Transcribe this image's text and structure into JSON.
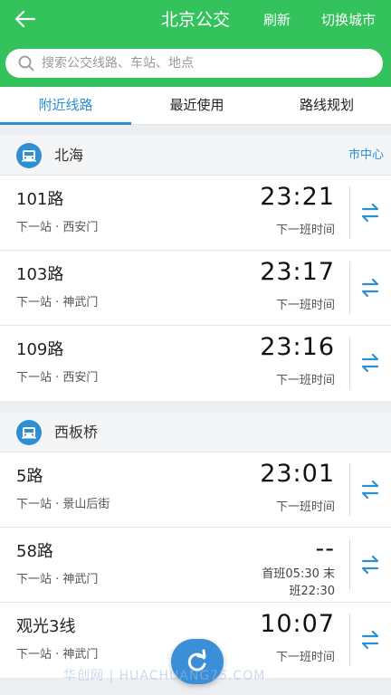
{
  "header": {
    "title": "北京公交",
    "refresh_label": "刷新",
    "switch_city_label": "切换城市"
  },
  "search": {
    "placeholder": "搜索公交线路、车站、地点"
  },
  "tabs": [
    {
      "label": "附近线路",
      "active": true
    },
    {
      "label": "最近使用",
      "active": false
    },
    {
      "label": "路线规划",
      "active": false
    }
  ],
  "groups": [
    {
      "stop_name": "北海",
      "area": "市中心",
      "routes": [
        {
          "name": "101路",
          "next_stop": "下一站 · 西安门",
          "time": "23:21",
          "time_label": "下一班时间"
        },
        {
          "name": "103路",
          "next_stop": "下一站 · 神武门",
          "time": "23:17",
          "time_label": "下一班时间"
        },
        {
          "name": "109路",
          "next_stop": "下一站 · 西安门",
          "time": "23:16",
          "time_label": "下一班时间"
        }
      ]
    },
    {
      "stop_name": "西板桥",
      "area": "",
      "routes": [
        {
          "name": "5路",
          "next_stop": "下一站 · 景山后街",
          "time": "23:01",
          "time_label": "下一班时间"
        },
        {
          "name": "58路",
          "next_stop": "下一站 · 神武门",
          "time": "--",
          "schedule_line1": "首班05:30 末",
          "schedule_line2": "班22:30"
        },
        {
          "name": "观光3线",
          "next_stop": "下一站 · 神武门",
          "time": "10:07",
          "time_label": "下一班时间"
        }
      ]
    }
  ],
  "watermark": "华创网 | HUACHUANG75.COM",
  "colors": {
    "header_green": "#33c25b",
    "accent_blue": "#2c8fd6",
    "fab_blue": "#3a8fd8"
  }
}
